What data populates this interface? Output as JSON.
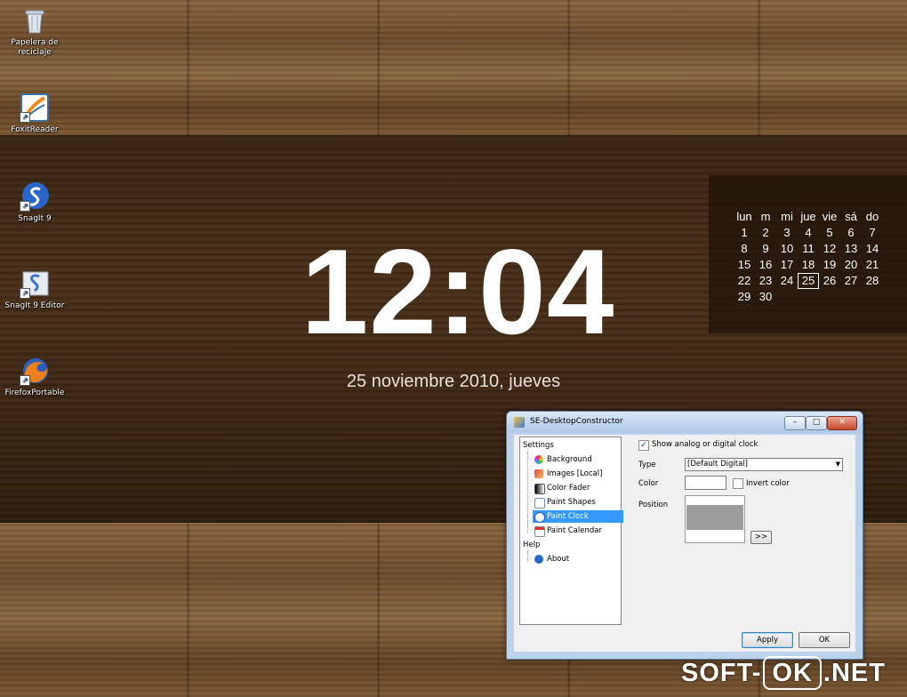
{
  "desktop": {
    "icons": [
      {
        "label": "Papelera de reciclaje"
      },
      {
        "label": "FoxitReader"
      },
      {
        "label": "SnagIt 9"
      },
      {
        "label": "SnagIt 9 Editor"
      },
      {
        "label": "FirefoxPortable"
      }
    ]
  },
  "clock": {
    "time": "12:04",
    "date": "25 noviembre 2010, jueves"
  },
  "calendar": {
    "weekdays": [
      "lun",
      "m",
      "mi",
      "jue",
      "vie",
      "sá",
      "do"
    ],
    "weeks": [
      [
        "1",
        "2",
        "3",
        "4",
        "5",
        "6",
        "7"
      ],
      [
        "8",
        "9",
        "10",
        "11",
        "12",
        "13",
        "14"
      ],
      [
        "15",
        "16",
        "17",
        "18",
        "19",
        "20",
        "21"
      ],
      [
        "22",
        "23",
        "24",
        "25",
        "26",
        "27",
        "28"
      ],
      [
        "29",
        "30",
        "",
        "",
        "",
        "",
        ""
      ]
    ],
    "today": "25"
  },
  "dialog": {
    "title": "SE-DesktopConstructor",
    "tree": {
      "settings_label": "Settings",
      "settings_items": [
        "Background",
        "Images [Local]",
        "Color Fader",
        "Paint Shapes",
        "Paint Clock",
        "Paint Calendar"
      ],
      "selected": "Paint Clock",
      "help_label": "Help",
      "help_items": [
        "About"
      ]
    },
    "show_clock_label": "Show analog or digital clock",
    "type_label": "Type",
    "type_value": "[Default Digital]",
    "color_label": "Color",
    "invert_color_label": "Invert color",
    "position_label": "Position",
    "more_button": ">>",
    "apply_button": "Apply",
    "ok_button": "OK"
  },
  "watermark": {
    "left": "SOFT-",
    "middle": "OK",
    "right": ".NET"
  },
  "colors": {
    "selection": "#3399ff",
    "titlebar": "#c2d6ee"
  }
}
